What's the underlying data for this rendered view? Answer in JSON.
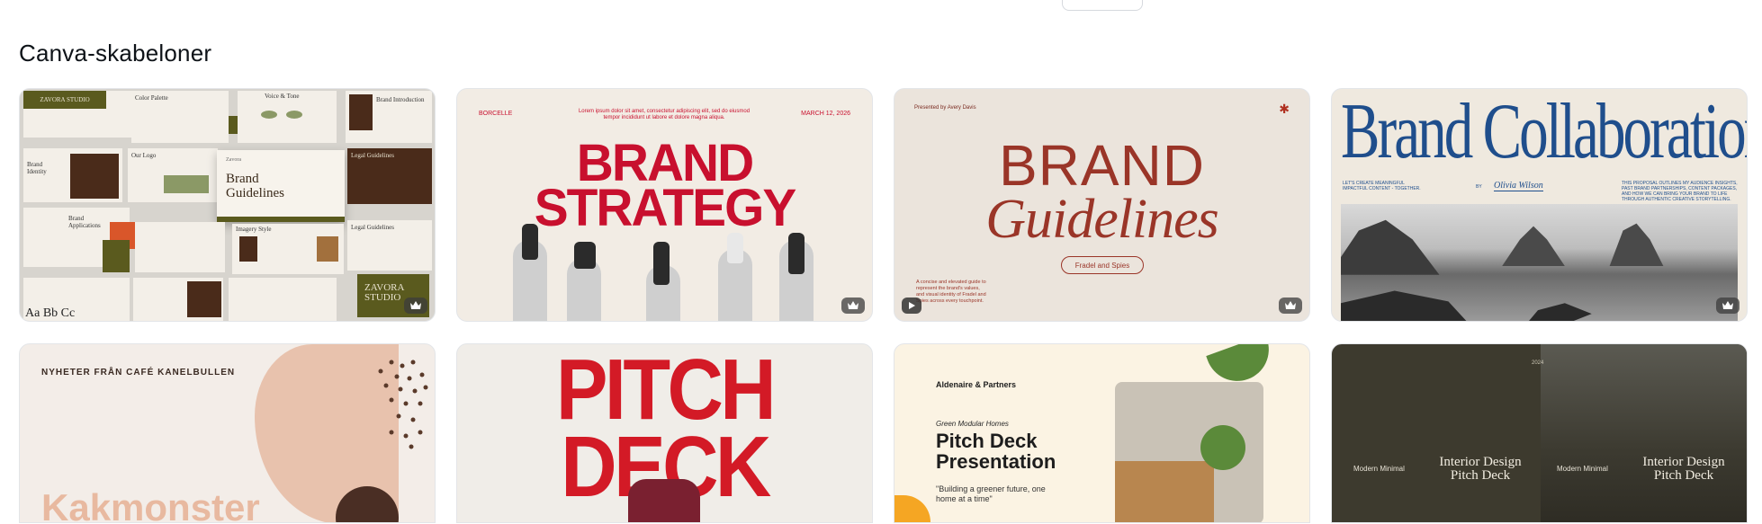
{
  "section": {
    "title": "Canva-skabeloner"
  },
  "templates": [
    {
      "id": "brand-introduction",
      "texts": {
        "studio": "ZAVORA STUDIO",
        "cover_line1": "Brand",
        "cover_line2": "Guidelines",
        "cover_sub": "Zavora",
        "color_palette": "Color Palette",
        "voice": "Voice & Tone",
        "brand_intro": "Brand Introduction",
        "brand_identity": "Brand Identity",
        "our_logo": "Our Logo",
        "brand_applications": "Brand Applications",
        "imagery": "Imagery Style",
        "legal": "Legal Guidelines",
        "aabb": "Aa Bb Cc",
        "zavora_closing": "ZAVORA STUDIO"
      },
      "premium": true
    },
    {
      "id": "brand-strategy",
      "texts": {
        "left": "BORCELLE",
        "center": "Lorem ipsum dolor sit amet, consectetur adipiscing elit, sed do eiusmod tempor incididunt ut labore et dolore magna aliqua.",
        "right": "MARCH 12, 2026",
        "line1": "BRAND",
        "line2": "STRATEGY"
      },
      "premium": true
    },
    {
      "id": "brand-guidelines",
      "texts": {
        "presented": "Presented by Avery Davis",
        "line1": "BRAND",
        "line2": "Guidelines",
        "pill": "Fradel and Spies",
        "note": "A concise and elevated guide to represent the brand's values, and visual identity of Fradel and Spies across every touchpoint."
      },
      "premium": true,
      "video": true
    },
    {
      "id": "brand-collaboration",
      "texts": {
        "title": "Brand Collaboration",
        "left_small": "LET'S CREATE MEANINGFUL IMPACTFUL CONTENT - TOGETHER.",
        "by": "BY",
        "signature": "Olivia Wilson",
        "right_small": "THIS PROPOSAL OUTLINES MY AUDIENCE INSIGHTS, PAST BRAND PARTNERSHIPS, CONTENT PACKAGES, AND HOW WE CAN BRING YOUR BRAND TO LIFE THROUGH AUTHENTIC CREATIVE STORYTELLING."
      },
      "premium": true
    },
    {
      "id": "kakmonster",
      "texts": {
        "header": "NYHETER FRÅN CAFÉ KANELBULLEN",
        "word": "Kakmonster"
      }
    },
    {
      "id": "pitch-deck",
      "texts": {
        "line1": "PITCH",
        "line2": "DECK"
      }
    },
    {
      "id": "pitch-deck-presentation",
      "texts": {
        "brand": "Aldenaire & Partners",
        "kicker": "Green Modular Homes",
        "title_line1": "Pitch Deck",
        "title_line2": "Presentation",
        "quote_line1": "\"Building a greener future, one",
        "quote_line2": "home at a time\""
      }
    },
    {
      "id": "interior-design-pitch-deck",
      "texts": {
        "year": "2024",
        "left_small": "Modern Minimal",
        "left_title1": "Interior Design",
        "left_title2": "Pitch Deck",
        "right_small": "Modern Minimal",
        "right_title1": "Interior Design",
        "right_title2": "Pitch Deck"
      }
    }
  ],
  "icons": {
    "premium": "crown-icon",
    "video": "play-icon"
  }
}
